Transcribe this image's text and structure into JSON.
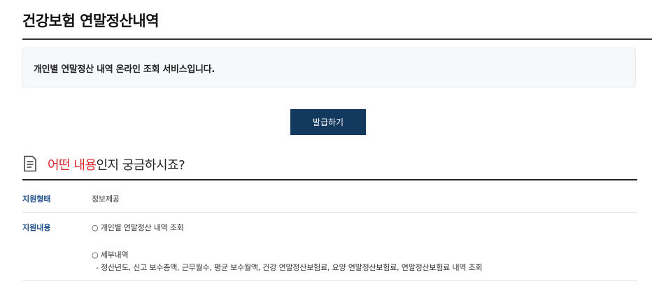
{
  "page": {
    "title": "건강보험 연말정산내역"
  },
  "info_box": {
    "text": "개인별 연말정산 내역 온라인 조회 서비스입니다."
  },
  "actions": {
    "issue_label": "발급하기"
  },
  "section": {
    "icon": "document-list-icon",
    "heading_accent": "어떤 내용",
    "heading_rest": "인지 궁금하시죠?"
  },
  "rows": [
    {
      "label": "지원형태",
      "lines": [
        "정보제공"
      ]
    },
    {
      "label": "지원내용",
      "lines": [
        "○ 개인별 연말정산 내역 조회",
        "○ 세부내역",
        "- 정산년도, 신고 보수총액, 근무월수, 평균 보수월액, 건강 연말정산보험료, 요양 연말정산보험료, 연말정산보험료 내역 조회"
      ]
    }
  ],
  "colors": {
    "button_bg": "#14395f",
    "accent_red": "#d8262a",
    "label_blue": "#1d4f8a"
  }
}
